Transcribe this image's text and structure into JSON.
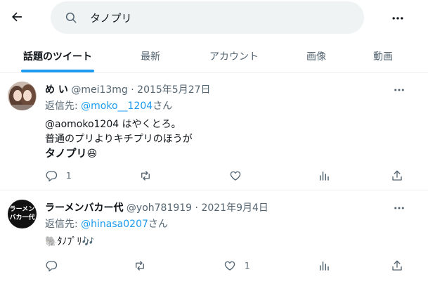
{
  "header": {
    "search_value": "タノプリ"
  },
  "tabs": [
    {
      "label": "話題のツイート"
    },
    {
      "label": "最新"
    },
    {
      "label": "アカウント"
    },
    {
      "label": "画像"
    },
    {
      "label": "動画"
    }
  ],
  "tweets": [
    {
      "name": "め い",
      "handle": "@mei13mg",
      "sep": "·",
      "date": "2015年5月27日",
      "reply_prefix": "返信先:",
      "reply_to": "@moko__1204",
      "reply_suffix": "さん",
      "lines": [
        "@aomoko1204 はやくとろ。",
        "普通のプリよりキチプリのほうが"
      ],
      "bold_line": "タノプリ",
      "emoji": "😆",
      "reply_count": "1",
      "like_count": ""
    },
    {
      "name": "ラーメンバカー代",
      "handle": "@yoh781919",
      "sep": "·",
      "date": "2021年9月4日",
      "reply_prefix": "返信先:",
      "reply_to": "@hinasa0207",
      "reply_suffix": "さん",
      "body_emoji_1": "🐘",
      "body_text": "ﾀﾉﾌﾟﾘ",
      "body_emoji_2": "🎶",
      "avatar_text_1": "ラーメン",
      "avatar_text_2": "バカ一代",
      "reply_count": "",
      "like_count": "1"
    }
  ]
}
